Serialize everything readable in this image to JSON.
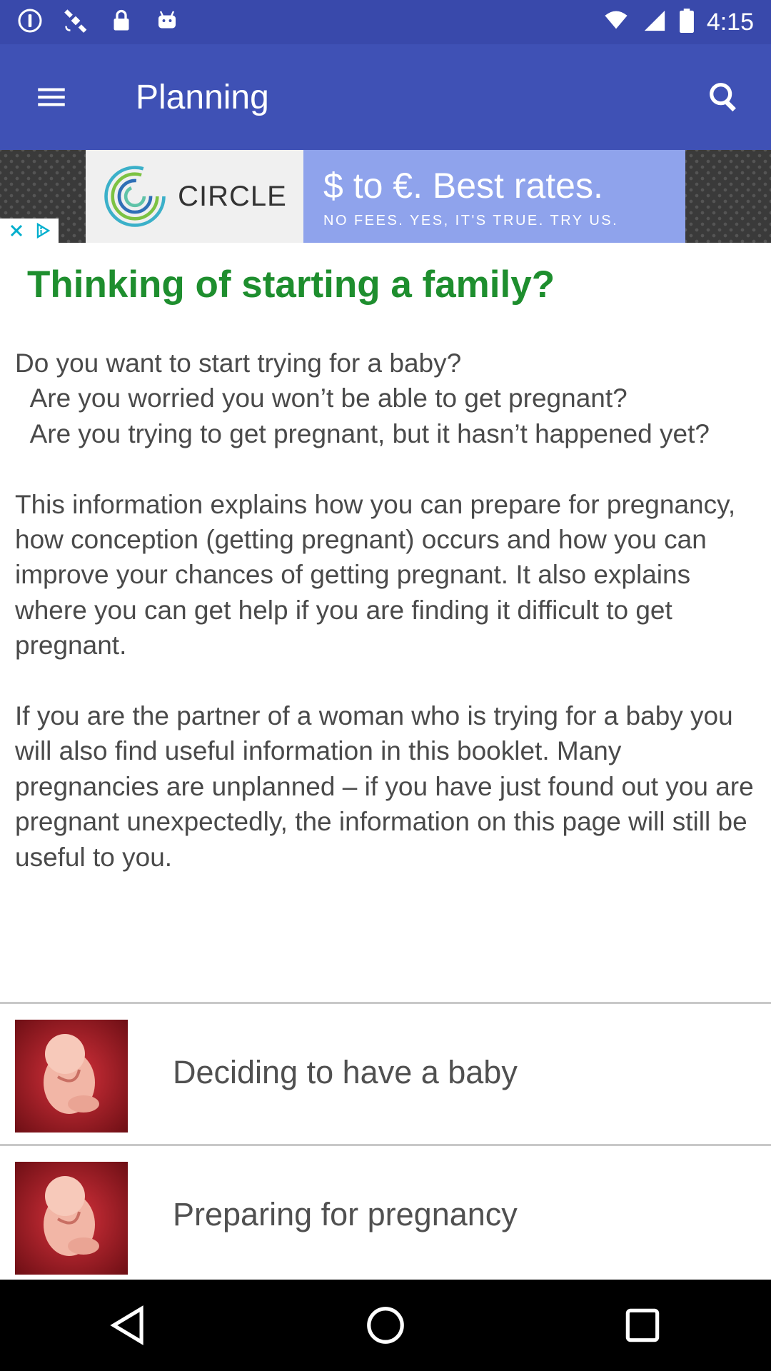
{
  "status_bar": {
    "time": "4:15",
    "icons": [
      "alert-circle-icon",
      "satellite-fake-gps-icon",
      "lock-icon",
      "android-icon",
      "wifi-icon",
      "signal-icon",
      "battery-icon"
    ]
  },
  "app_bar": {
    "title": "Planning",
    "menu_icon": "hamburger-menu-icon",
    "search_icon": "search-icon"
  },
  "ad": {
    "brand": "CIRCLE",
    "headline": "$ to €. Best rates.",
    "subline": "NO FEES. YES, IT'S TRUE. TRY US.",
    "controls": [
      "close-icon",
      "adchoices-icon"
    ]
  },
  "article": {
    "heading": "Thinking of starting a family?",
    "paragraphs": [
      "Do you want to start trying for a baby?\n  Are you worried you won’t be able to get pregnant?\n  Are you trying to get pregnant, but it hasn’t happened yet?",
      "This information explains how you can prepare for pregnancy, how conception (getting pregnant) occurs and how you can improve your chances of getting pregnant. It also explains where you can get help if you are finding it difficult to get pregnant.",
      "If you are the partner of a woman who is trying for a baby you will also find useful information in this booklet. Many pregnancies are unplanned – if you have just found out you are pregnant unexpectedly, the information on this page will still be useful to you."
    ]
  },
  "topics": [
    {
      "label": "Deciding to have a baby",
      "thumb": "fetus-image"
    },
    {
      "label": "Preparing for pregnancy",
      "thumb": "fetus-image"
    }
  ],
  "nav_bar": {
    "buttons": [
      "back-triangle-icon",
      "home-circle-icon",
      "recents-square-icon"
    ]
  },
  "colors": {
    "status_bar": "#3949ab",
    "app_bar": "#3f51b5",
    "heading_green": "#1e8e2e",
    "body_text": "#4a4a4a",
    "ad_blue": "#8fa3ec"
  }
}
